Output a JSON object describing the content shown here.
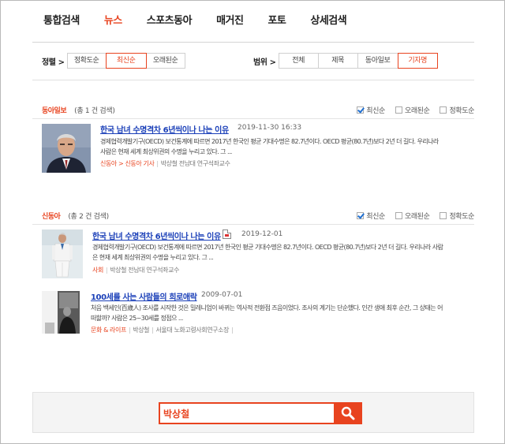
{
  "nav": {
    "tabs": [
      {
        "label": "통합검색"
      },
      {
        "label": "뉴스"
      },
      {
        "label": "스포츠동아"
      },
      {
        "label": "매거진"
      },
      {
        "label": "포토"
      },
      {
        "label": "상세검색"
      }
    ],
    "active": 1
  },
  "filters": {
    "sort_label": "정렬 >",
    "sort_options": [
      "정확도순",
      "최신순",
      "오래된순"
    ],
    "range_label": "범위 >",
    "range_options": [
      "전체",
      "제목",
      "동아일보",
      "기자명"
    ]
  },
  "sections": [
    {
      "name": "동아일보",
      "count": "(총 1 건 검색)",
      "sorts": [
        "최신순",
        "오래된순",
        "정확도순"
      ],
      "articles": [
        {
          "title": "한국 남녀 수명격차 6년씩이나 나는 이유",
          "date": "2019-11-30 16:33",
          "summary": "경제협력개발기구(OECD) 보건통계에 따르면 2017년 한국인 평균 기대수명은 82.7년이다. OECD 평균(80.7년)보다 2년 더 길다. 우리나라 사람은 현재 세계 최상위권의 수명을 누리고 있다. 그 ...",
          "category": "신동아 > 신동아 기사",
          "author": "박상철 전남대 연구석좌교수"
        }
      ]
    },
    {
      "name": "신동아",
      "count": "(총 2 건 검색)",
      "sorts": [
        "최신순",
        "오래된순",
        "정확도순"
      ],
      "articles": [
        {
          "title": "한국 남녀 수명격차 6년씩이나 나는 이유",
          "date": "2019-12-01",
          "summary": "경제협력개발기구(OECD) 보건통계에 따르면 2017년 한국인 평균 기대수명은 82.7년이다. OECD 평균(80.7년)보다 2년 더 길다. 우리나라 사람은 현재 세계 최상위권의 수명을 누리고 있다. 그 ...",
          "category": "사회",
          "author": "박상철 전남대 연구석좌교수"
        },
        {
          "title": "100세를 사는 사람들의 희로애락",
          "date": "2009-07-01",
          "summary": "처음 백세인(百歲人) 조사를 시작한 것은 밀레니엄이 바뀌는 역사적 전환점 즈음이었다. 조사의 계기는 단순했다. 인간 생애 최후 순간, 그 상태는 어떠할까? 사람은 25~30세를 정점으 ...",
          "category": "문화 & 라이프",
          "author": "박상철",
          "author2": "서울대 노화고령사회연구소장"
        }
      ]
    }
  ],
  "search": {
    "value": "박상철"
  }
}
